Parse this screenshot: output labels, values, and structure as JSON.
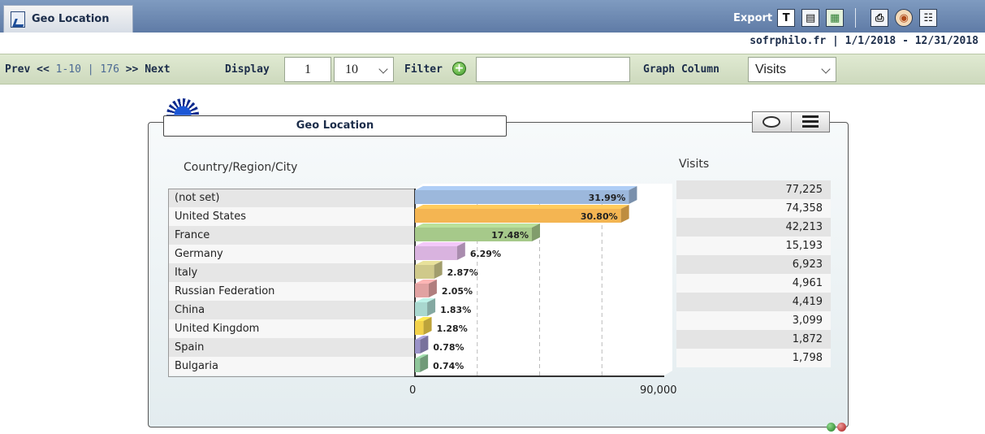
{
  "title_bar": {
    "tab_label": "Geo Location",
    "export_label": "Export",
    "export_text_button": "T",
    "icons": [
      "text-export-icon",
      "report-export-icon",
      "excel-export-icon",
      "print-icon",
      "share-icon",
      "schedule-icon"
    ]
  },
  "info": {
    "site_and_range": "sofrphilo.fr | 1/1/2018 - 12/31/2018"
  },
  "toolbar": {
    "prev_label": "Prev",
    "prev_arrows": "<<",
    "range_text": "1-10",
    "separator": "|",
    "total": "176",
    "next_arrows": ">>",
    "next_label": "Next",
    "display_label": "Display",
    "display_value": "1",
    "per_page_value": "10",
    "filter_label": "Filter",
    "filter_value": "",
    "graph_column_label": "Graph Column",
    "graph_column_value": "Visits"
  },
  "chart": {
    "title": "Geo Location",
    "label_header": "Country/Region/City",
    "value_header": "Visits"
  },
  "chart_data": {
    "type": "bar",
    "orientation": "horizontal",
    "categories": [
      "(not set)",
      "United States",
      "France",
      "Germany",
      "Italy",
      "Russian Federation",
      "China",
      "United Kingdom",
      "Spain",
      "Bulgaria"
    ],
    "values": [
      77225,
      74358,
      42213,
      15193,
      6923,
      4961,
      4419,
      3099,
      1872,
      1798
    ],
    "value_labels": [
      "77,225",
      "74,358",
      "42,213",
      "15,193",
      "6,923",
      "4,961",
      "4,419",
      "3,099",
      "1,872",
      "1,798"
    ],
    "percent_labels": [
      "31.99%",
      "30.80%",
      "17.48%",
      "6.29%",
      "2.87%",
      "2.05%",
      "1.83%",
      "1.28%",
      "0.78%",
      "0.74%"
    ],
    "colors": [
      "#9cb8dc",
      "#f4b552",
      "#a6c98a",
      "#d9b3df",
      "#cfc98a",
      "#e1a2a2",
      "#a9d8cf",
      "#f2d14a",
      "#9a92c8",
      "#8fc69a"
    ],
    "xlim": [
      0,
      90000
    ],
    "tick_labels": [
      "0",
      "90,000"
    ]
  }
}
